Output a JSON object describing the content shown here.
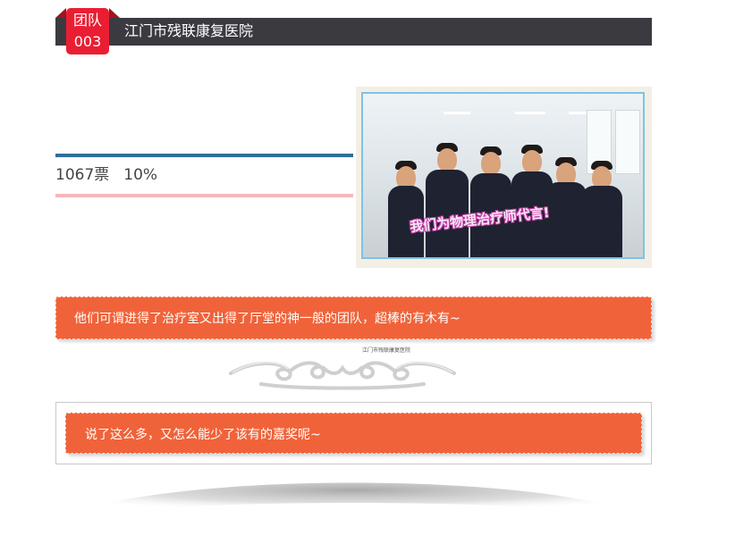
{
  "header": {
    "badge_line1": "团队",
    "badge_line2": "003",
    "title": "江门市残联康复医院"
  },
  "vote": {
    "count": "1067票",
    "percent": "10%"
  },
  "photo": {
    "caption": "我们为物理治疗师代言!",
    "watermark": "江门市残联康复医院"
  },
  "banner1": {
    "text": "他们可谓进得了治疗室又出得了厅堂的神一般的团队，超棒的有木有~"
  },
  "banner2": {
    "text": "说了这么多，又怎么能少了该有的嘉奖呢~"
  },
  "colors": {
    "header_bg": "#3b3a41",
    "badge": "#ea1e33",
    "banner": "#f0633a",
    "bar_top": "#2f6f99",
    "bar_bottom": "#f4b8b8"
  }
}
